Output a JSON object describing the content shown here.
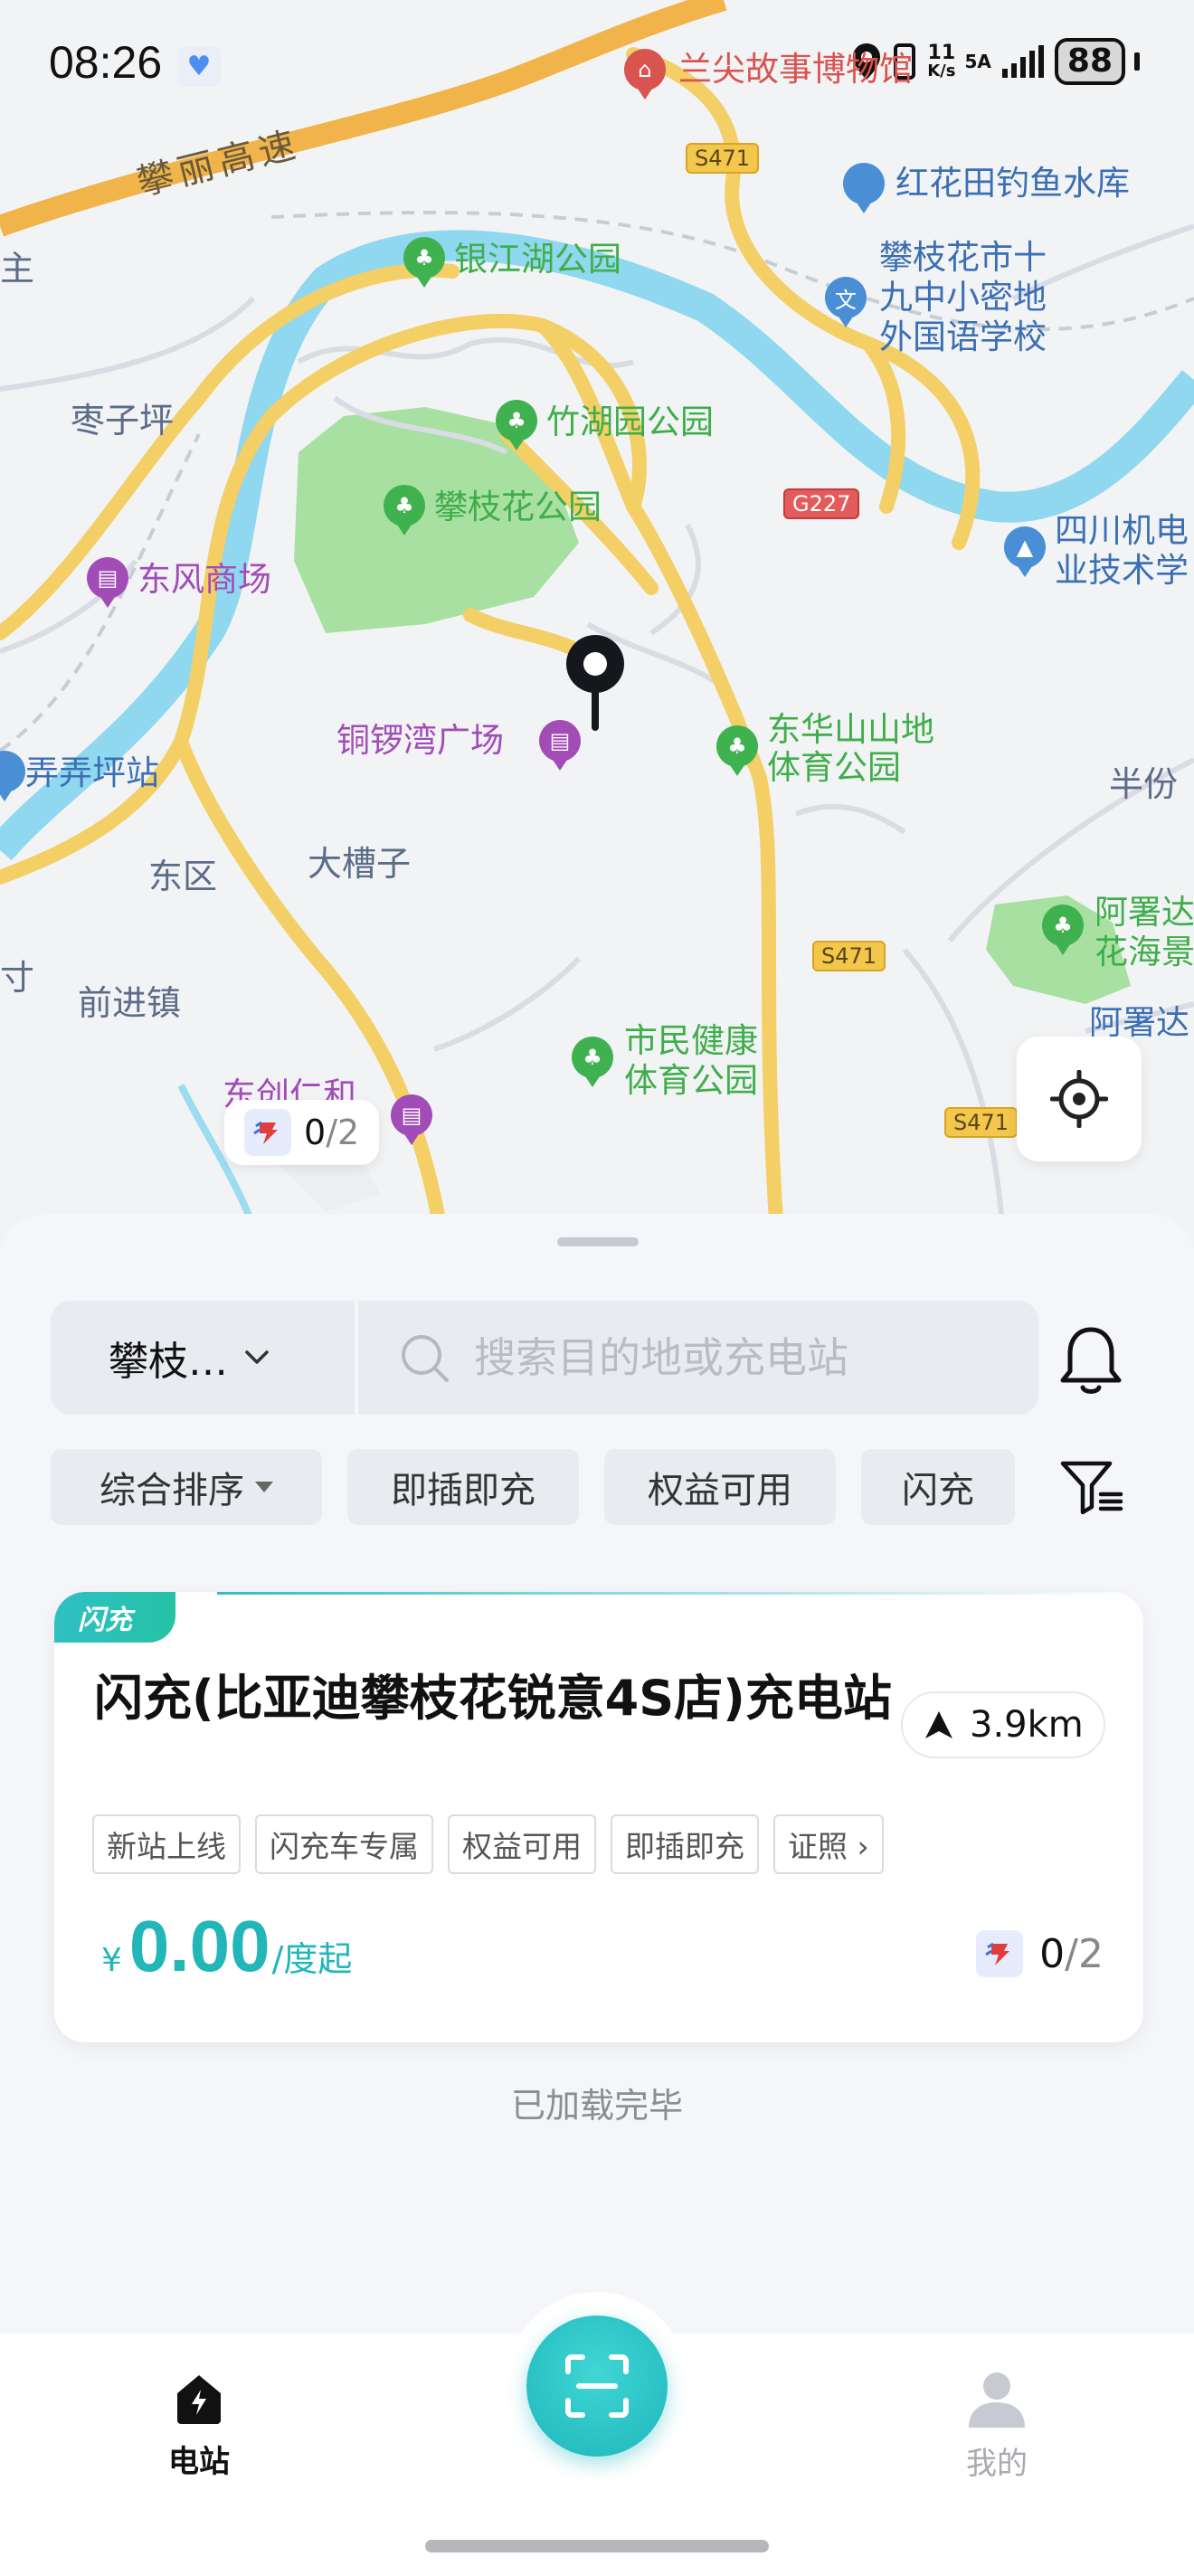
{
  "status_bar": {
    "time": "08:26",
    "network_speed": "11",
    "network_unit": "K/s",
    "signal_label": "5A",
    "battery": "88"
  },
  "map": {
    "labels": {
      "highway": "攀丽高速",
      "museum": "兰尖故事博物馆",
      "reservoir": "红花田钓鱼水库",
      "school": "攀枝花市十九中小密地外国语学校",
      "school_line1": "攀枝花市十",
      "school_line2": "九中小密地",
      "school_line3": "外国语学校",
      "yinjiang_park": "银江湖公园",
      "zaoziping": "枣子坪",
      "zhuhu_park": "竹湖园公园",
      "panzhihua_park": "攀枝花公园",
      "dongfeng_mall": "东风商场",
      "college_line1": "四川机电",
      "college_line2": "业技术学",
      "tongluowan_plaza": "铜锣湾广场",
      "donghua_line1": "东华山山地",
      "donghua_line2": "体育公园",
      "nongnongping": "弄弄坪站",
      "banfen": "半份",
      "east_district": "东区",
      "dacaozi": "大槽子",
      "qianjin_town": "前进镇",
      "ashu_line1": "阿署达",
      "ashu_line2": "花海景",
      "ashu_3": "阿署达",
      "citizen_line1": "市民健康",
      "citizen_line2": "体育公园",
      "dongchuang": "东创仁和",
      "left_edge_1": "主",
      "left_edge_2": "寸"
    },
    "shields": {
      "s471_top": "S471",
      "g227": "G227",
      "s471_mid": "S471",
      "s471_bottom": "S471"
    },
    "bubble": {
      "available": "0",
      "total": "/2"
    }
  },
  "search": {
    "city": "攀枝…",
    "placeholder": "搜索目的地或充电站"
  },
  "filters": {
    "sort": "综合排序",
    "plug_and_charge": "即插即充",
    "benefits": "权益可用",
    "flash": "闪充"
  },
  "station": {
    "badge": "闪充",
    "name": "闪充(比亚迪攀枝花锐意4S店)充电站",
    "distance": "3.9km",
    "tags": [
      "新站上线",
      "闪充车专属",
      "权益可用",
      "即插即充",
      "证照 ›"
    ],
    "price_currency": "¥",
    "price": "0.00",
    "price_unit": "/度起",
    "available": "0",
    "total": "/2"
  },
  "list_footer": "已加载完毕",
  "nav": {
    "station": "电站",
    "mine": "我的"
  },
  "colors": {
    "accent": "#22b6b8",
    "road_main": "#f3c74c",
    "river": "#8fd8ef",
    "park": "#9fdc9a"
  }
}
